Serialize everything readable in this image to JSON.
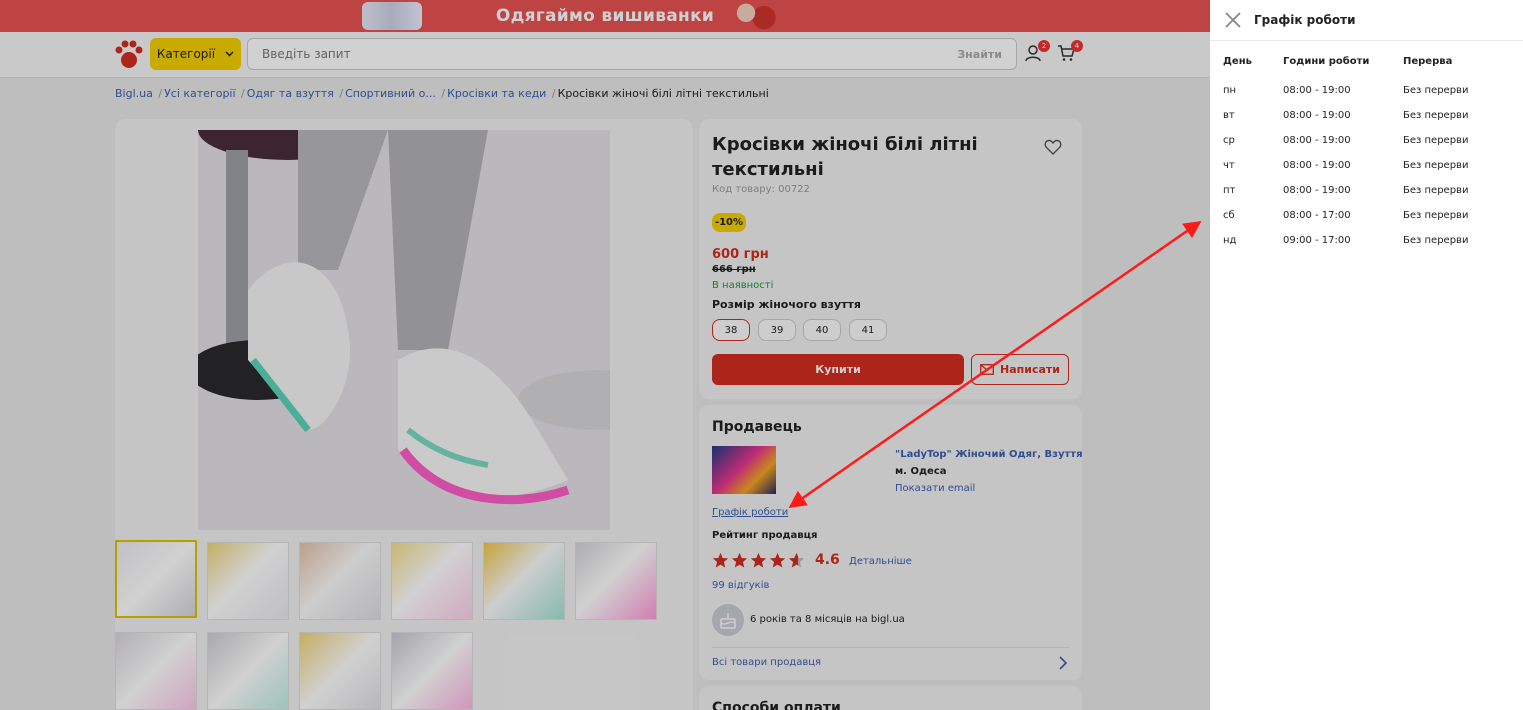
{
  "promo": {
    "text": "Одягаймо вишиванки"
  },
  "header": {
    "categories_label": "Категорії",
    "search_placeholder": "Введіть запит",
    "search_button": "Знайти",
    "profile_badge": "2",
    "cart_badge": "4"
  },
  "breadcrumbs": [
    "Bigl.ua",
    "Усі категорії",
    "Одяг та взуття",
    "Спортивний о...",
    "Кросівки та кеди",
    "Кросівки жіночі білі літні текстильні"
  ],
  "product": {
    "title": "Кросівки жіночі білі літні текстильні",
    "code": "Код товару: 00722",
    "discount": "-10%",
    "price": "600 грн",
    "old_price": "666 грн",
    "stock": "В наявності",
    "size_label": "Розмір жіночого взуття",
    "sizes": [
      "38",
      "39",
      "40",
      "41"
    ],
    "selected_size": "38",
    "buy_label": "Купити",
    "write_label": "Написати"
  },
  "seller": {
    "heading": "Продавець",
    "name": "\"LadyTop\" Жіночий Одяг, Взуття",
    "city": "м. Одеса",
    "email_link": "Показати email",
    "schedule_link": "Графік роботи",
    "rating_heading": "Рейтинг продавця",
    "rating": "4.6",
    "rating_value": 4.6,
    "details_link": "Детальніше",
    "reviews": "99 відгуків",
    "age": "6 років та 8 місяців на bigl.ua",
    "all_products": "Всі товари продавця"
  },
  "payment": {
    "heading": "Способи оплати"
  },
  "panel": {
    "title": "Графік роботи",
    "columns": [
      "День",
      "Години роботи",
      "Перерва"
    ],
    "rows": [
      [
        "пн",
        "08:00 - 19:00",
        "Без перерви"
      ],
      [
        "вт",
        "08:00 - 19:00",
        "Без перерви"
      ],
      [
        "ср",
        "08:00 - 19:00",
        "Без перерви"
      ],
      [
        "чт",
        "08:00 - 19:00",
        "Без перерви"
      ],
      [
        "пт",
        "08:00 - 19:00",
        "Без перерви"
      ],
      [
        "сб",
        "08:00 - 17:00",
        "Без перерви"
      ],
      [
        "нд",
        "09:00 - 17:00",
        "Без перерви"
      ]
    ]
  },
  "colors": {
    "accent": "#d32d20",
    "yellow": "#f5d000",
    "link": "#3a5fb0",
    "promo": "#e85252",
    "annotation": "#ff1a1a"
  }
}
